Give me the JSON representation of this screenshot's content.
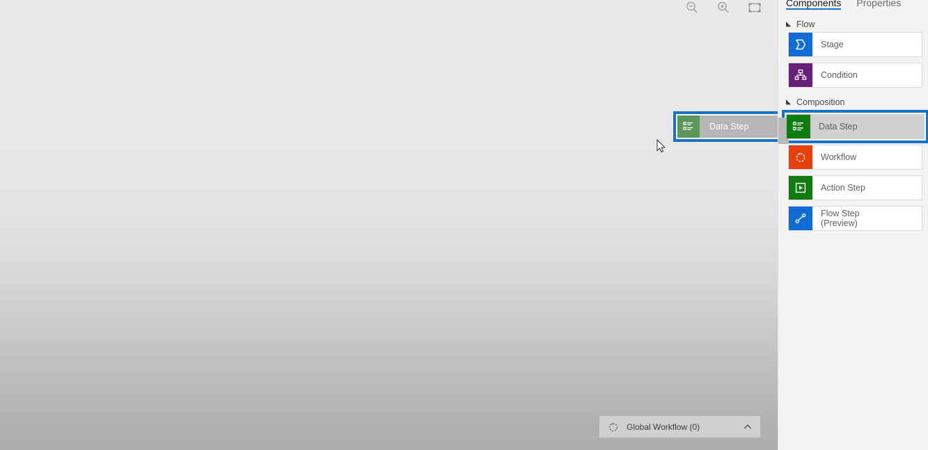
{
  "canvas": {
    "zoom_controls": [
      {
        "name": "zoom-out-icon",
        "label": "Zoom out"
      },
      {
        "name": "zoom-in-icon",
        "label": "Zoom in"
      },
      {
        "name": "fit-to-screen-icon",
        "label": "Fit to screen"
      }
    ],
    "dragged_item": {
      "label": "Data Step",
      "icon": "data-step-icon"
    },
    "global_workflow": {
      "label": "Global Workflow (0)",
      "icon": "workflow-circle-icon",
      "chevron": "chevron-up-icon"
    }
  },
  "side_panel": {
    "tabs": [
      {
        "label": "Components",
        "active": true
      },
      {
        "label": "Properties",
        "active": false
      }
    ],
    "groups": [
      {
        "title": "Flow",
        "expanded": true,
        "items": [
          {
            "label": "Stage",
            "icon": "stage-icon",
            "color": "#0f6cd4",
            "selected": false
          },
          {
            "label": "Condition",
            "icon": "condition-icon",
            "color": "#68217a",
            "selected": false
          }
        ]
      },
      {
        "title": "Composition",
        "expanded": true,
        "items": [
          {
            "label": "Data Step",
            "icon": "data-step-icon",
            "color": "#107c10",
            "selected": true
          },
          {
            "label": "Workflow",
            "icon": "workflow-circle-icon",
            "color": "#e8400c",
            "selected": false
          },
          {
            "label": "Action Step",
            "icon": "action-step-icon",
            "color": "#107c10",
            "selected": false
          },
          {
            "label": "Flow Step\n(Preview)",
            "icon": "flow-step-icon",
            "color": "#0f6cd4",
            "selected": false
          }
        ]
      }
    ]
  },
  "colors": {
    "accent_blue": "#1673c8",
    "selection_border": "#1673c8",
    "panel_background": "#f3f3f3",
    "canvas_top": "#e9e9e9",
    "canvas_bottom": "#adadad",
    "stage_blue": "#0f6cd4",
    "condition_purple": "#68217a",
    "data_step_green": "#107c10",
    "workflow_orange": "#e8400c",
    "action_step_green": "#107c10",
    "flow_step_blue": "#0f6cd4"
  }
}
